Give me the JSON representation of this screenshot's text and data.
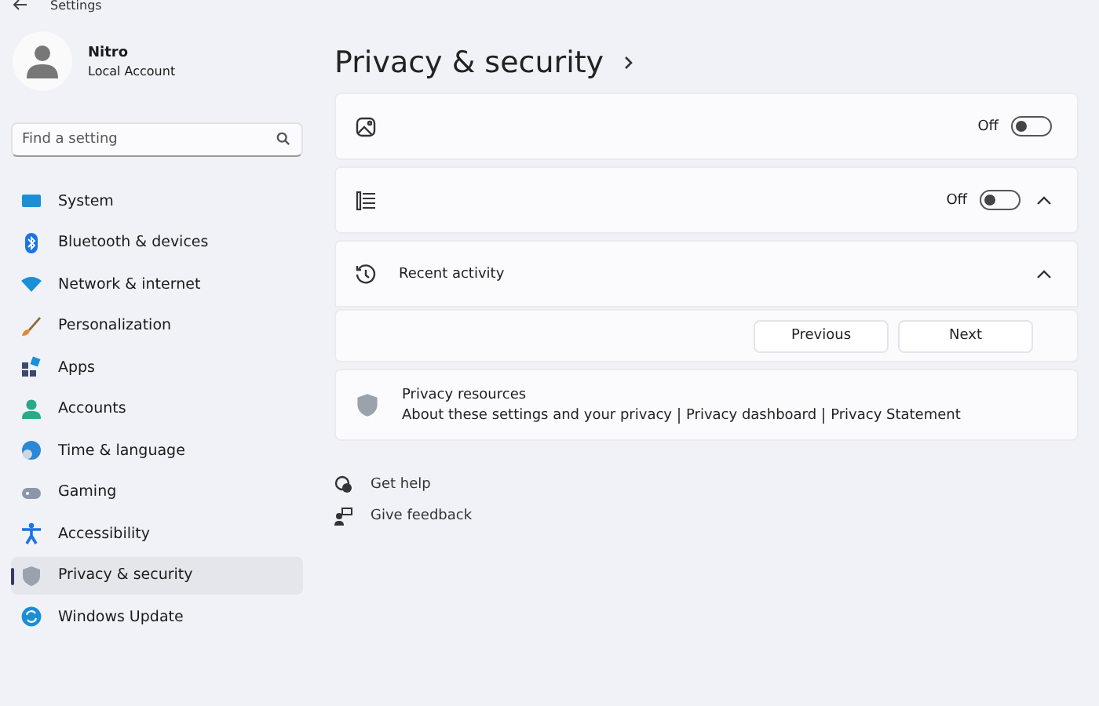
{
  "window": {
    "title": "Settings"
  },
  "account": {
    "name": "Nitro",
    "type": "Local Account"
  },
  "search": {
    "placeholder": "Find a setting"
  },
  "nav": [
    {
      "label": "System",
      "selected": false
    },
    {
      "label": "Bluetooth & devices",
      "selected": false
    },
    {
      "label": "Network & internet",
      "selected": false
    },
    {
      "label": "Personalization",
      "selected": false
    },
    {
      "label": "Apps",
      "selected": false
    },
    {
      "label": "Accounts",
      "selected": false
    },
    {
      "label": "Time & language",
      "selected": false
    },
    {
      "label": "Gaming",
      "selected": false
    },
    {
      "label": "Accessibility",
      "selected": false
    },
    {
      "label": "Privacy & security",
      "selected": true
    },
    {
      "label": "Windows Update",
      "selected": false
    }
  ],
  "page": {
    "title": "Privacy & security"
  },
  "settings": [
    {
      "kind": "toggle",
      "state_label": "Off",
      "on": false
    },
    {
      "kind": "toggle",
      "state_label": "Off",
      "on": false,
      "expanded": true
    },
    {
      "kind": "expander",
      "label": "Recent activity",
      "expanded": true,
      "buttons": [
        "Previous",
        "Next"
      ]
    }
  ],
  "resources": {
    "title": "Privacy resources",
    "links": [
      "About these settings and your privacy",
      "Privacy dashboard",
      "Privacy Statement"
    ]
  },
  "help_links": [
    "Get help",
    "Give feedback"
  ]
}
